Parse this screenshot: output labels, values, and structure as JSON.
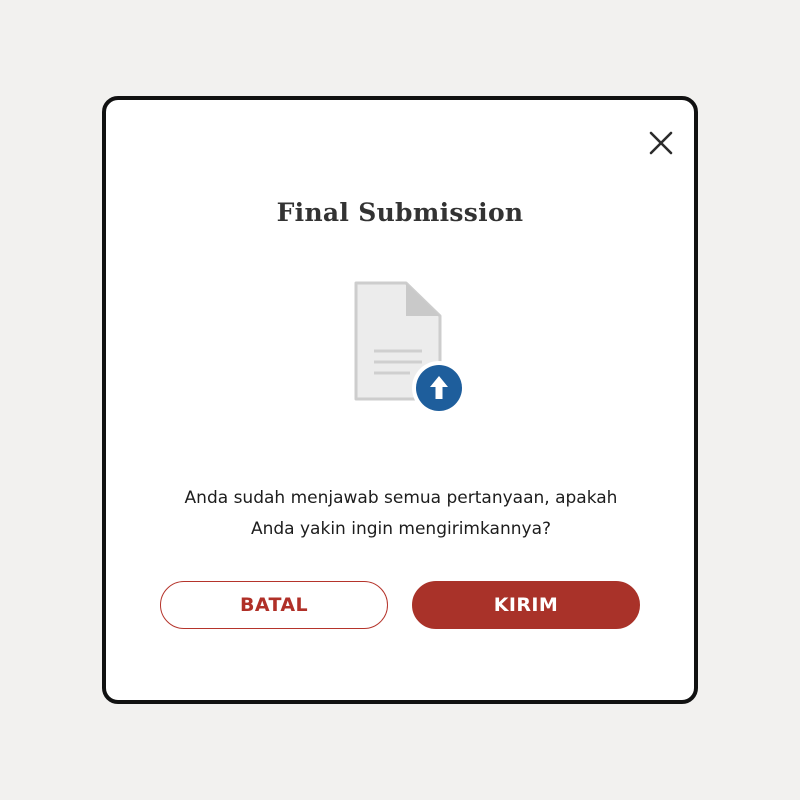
{
  "dialog": {
    "title": "Final Submission",
    "message_line1": "Anda sudah menjawab semua pertanyaan, apakah",
    "message_line2": "Anda yakin ingin mengirimkannya?",
    "cancel_label": "BATAL",
    "submit_label": "KIRIM",
    "icons": {
      "close": "close-icon",
      "illustration": "document-upload-icon"
    }
  },
  "colors": {
    "background": "#f2f1ef",
    "dialog_border": "#111111",
    "primary": "#a93229",
    "upload_badge": "#1e5e9c",
    "document": "#ececec"
  }
}
